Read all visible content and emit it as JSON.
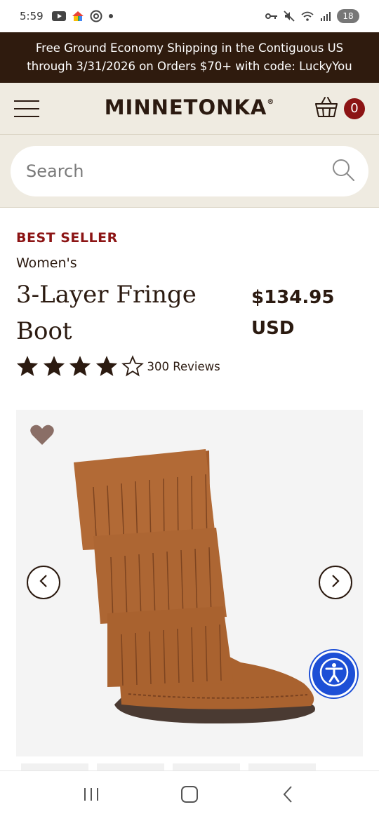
{
  "status_bar": {
    "time": "5:59",
    "battery": "18",
    "icons": [
      "youtube-icon",
      "google-home-icon",
      "threads-icon",
      "dot-icon",
      "vpn-key-icon",
      "mute-icon",
      "wifi-icon",
      "signal-icon"
    ]
  },
  "promo": {
    "line1": "Free Ground Economy Shipping in the Contiguous US",
    "line2": "through 3/31/2026 on Orders $70+ with code: LuckyYou"
  },
  "header": {
    "logo": "MINNETONKA",
    "logo_mark": "®",
    "cart_count": "0"
  },
  "search": {
    "placeholder": "Search"
  },
  "product": {
    "badge": "BEST SELLER",
    "category": "Women's",
    "title": "3-Layer Fringe Boot",
    "price": "$134.95 USD",
    "rating": 4,
    "rating_max": 5,
    "reviews": "300 Reviews"
  },
  "colors": {
    "brand_dark": "#2f1b0e",
    "header_bg": "#efebe1",
    "accent_red": "#8c1414",
    "a11y_blue": "#1d4fd6",
    "boot_suede": "#a9622f"
  }
}
